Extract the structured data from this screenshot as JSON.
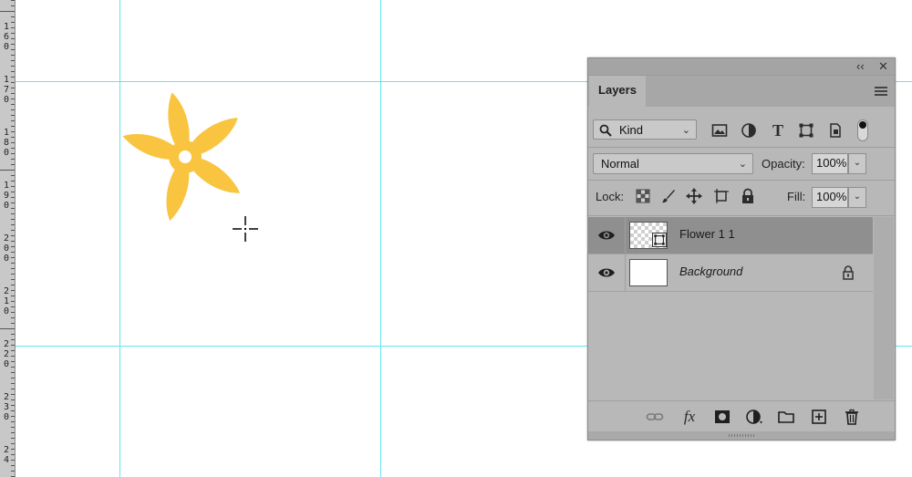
{
  "ruler": {
    "labels": [
      "1\n6\n0",
      "1\n7\n0",
      "1\n8\n0",
      "1\n9\n0",
      "2\n0\n0",
      "2\n1\n0",
      "2\n2\n0",
      "2\n3\n0",
      "2\n4"
    ]
  },
  "canvas": {
    "flower_color": "#f9c440",
    "guide_color": "#5ee7ee"
  },
  "panel": {
    "collapse_label": "‹‹",
    "close_label": "✕",
    "tab_label": "Layers",
    "filter": {
      "kind_label": "Kind",
      "icons": [
        "image-filter-icon",
        "adjustment-filter-icon",
        "type-filter-icon",
        "shape-filter-icon",
        "smart-object-filter-icon"
      ]
    },
    "blend_mode": "Normal",
    "opacity_label": "Opacity:",
    "opacity_value": "100%",
    "lock_label": "Lock:",
    "fill_label": "Fill:",
    "fill_value": "100%",
    "layers": [
      {
        "name": "Flower 1 1",
        "visible": true,
        "selected": true,
        "italic": false,
        "type": "smart-object"
      },
      {
        "name": "Background",
        "visible": true,
        "selected": false,
        "italic": true,
        "locked": true
      }
    ],
    "bottom_icons": [
      "link-layers-icon",
      "fx-icon",
      "mask-icon",
      "adjustment-layer-icon",
      "group-folder-icon",
      "new-layer-icon",
      "delete-layer-icon"
    ],
    "fx_label": "fx"
  }
}
